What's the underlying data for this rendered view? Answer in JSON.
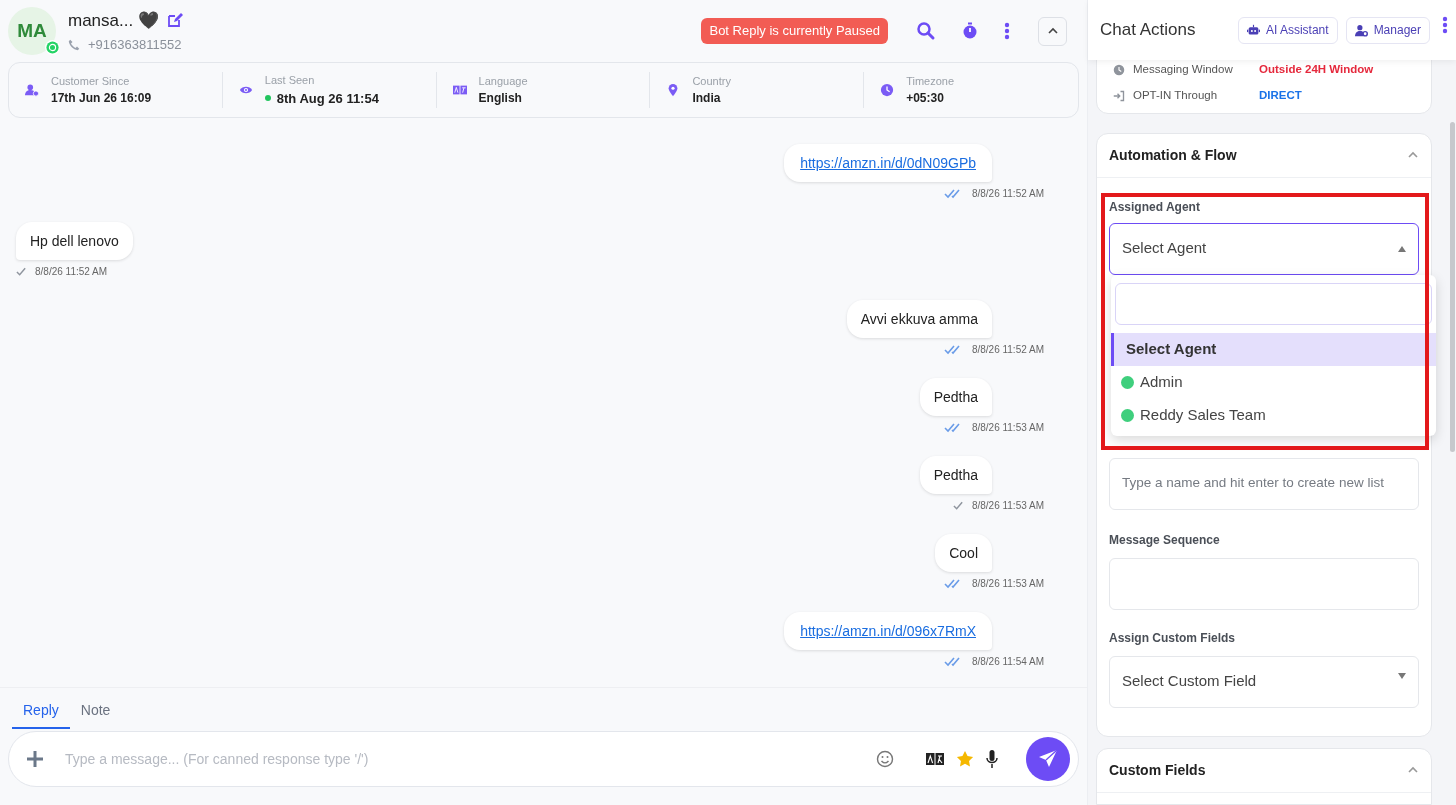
{
  "contact": {
    "initials": "MA",
    "name": "mansa... 🖤",
    "phone": "+916363811552"
  },
  "header": {
    "bot_status": "Bot Reply is currently Paused"
  },
  "info": [
    {
      "kind": "customer",
      "label": "Customer Since",
      "value": "17th Jun 26 16:09"
    },
    {
      "kind": "seen",
      "label": "Last Seen",
      "value": "8th Aug 26 11:54",
      "online": true
    },
    {
      "kind": "language",
      "label": "Language",
      "value": "English"
    },
    {
      "kind": "country",
      "label": "Country",
      "value": "India"
    },
    {
      "kind": "timezone",
      "label": "Timezone",
      "value": "+05:30"
    }
  ],
  "messages": [
    {
      "outgoing": true,
      "kind": "link",
      "text": "https://amzn.in/d/0dN09GPb",
      "time": "8/8/26 11:52 AM",
      "read": true
    },
    {
      "outgoing": false,
      "kind": "text",
      "text": "Hp dell lenovo",
      "time": "8/8/26 11:52 AM",
      "read": false
    },
    {
      "outgoing": true,
      "kind": "text",
      "text": "Avvi ekkuva amma",
      "time": "8/8/26 11:52 AM",
      "read": true
    },
    {
      "outgoing": true,
      "kind": "text",
      "text": "Pedtha",
      "time": "8/8/26 11:53 AM",
      "read": true
    },
    {
      "outgoing": true,
      "kind": "text",
      "text": "Pedtha",
      "time": "8/8/26 11:53 AM",
      "read": false
    },
    {
      "outgoing": true,
      "kind": "text",
      "text": "Cool",
      "time": "8/8/26 11:53 AM",
      "read": true
    },
    {
      "outgoing": true,
      "kind": "link",
      "text": "https://amzn.in/d/096x7RmX",
      "time": "8/8/26 11:54 AM",
      "read": true
    }
  ],
  "composer": {
    "tabs": [
      {
        "label": "Reply",
        "selected": true
      },
      {
        "label": "Note",
        "selected": false
      }
    ],
    "placeholder": "Type a message... (For canned response type '/')"
  },
  "panel": {
    "title": "Chat Actions",
    "buttons": [
      {
        "kind": "robot",
        "label": "AI Assistant"
      },
      {
        "kind": "manager",
        "label": "Manager"
      }
    ],
    "details": [
      {
        "kind": "clock",
        "label": "Messaging Window",
        "value": "Outside 24H Window",
        "color": "#e5283c"
      },
      {
        "kind": "login",
        "label": "OPT-IN Through",
        "value": "DIRECT",
        "color": "#1a73e8"
      }
    ],
    "automation": {
      "title": "Automation & Flow",
      "expanded": true,
      "agent_label": "Assigned Agent",
      "agent_value": "Select Agent",
      "agent_options": [
        {
          "label": "Select Agent",
          "selected": true
        },
        {
          "label": "Admin",
          "selected": false
        },
        {
          "label": "Reddy Sales Team",
          "selected": false
        }
      ],
      "list_placeholder": "Type a name and hit enter to create new list",
      "sequence_label": "Message Sequence",
      "custom_label": "Assign Custom Fields",
      "custom_value": "Select Custom Field"
    },
    "custom_fields": {
      "title": "Custom Fields",
      "expanded": true
    }
  }
}
